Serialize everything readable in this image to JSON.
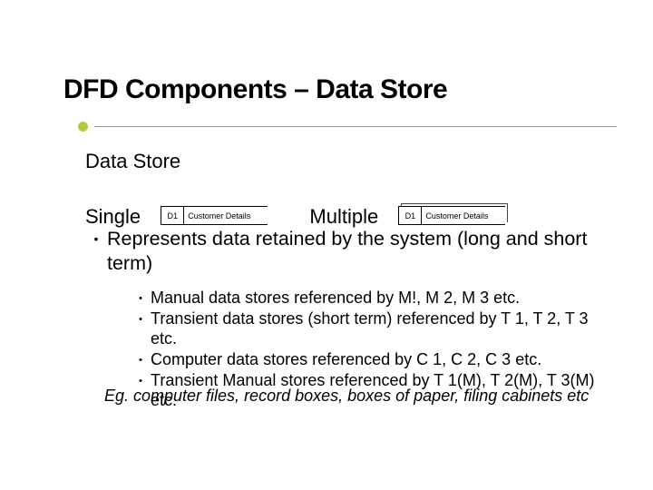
{
  "title": "DFD Components – Data Store",
  "subheading": "Data Store",
  "types": {
    "single": {
      "label": "Single",
      "box_id": "D1",
      "box_label": "Customer Details"
    },
    "multiple": {
      "label": "Multiple",
      "box_id": "D1",
      "box_label": "Customer Details"
    }
  },
  "main_bullet": "Represents data retained by the system (long and short term)",
  "sub_bullets": [
    "Manual data stores referenced by M!, M 2, M 3 etc.",
    "Transient data stores (short term) referenced by T 1, T 2, T 3 etc.",
    "Computer data stores referenced by C 1, C 2, C 3 etc.",
    "Transient Manual stores referenced by T 1(M), T 2(M), T 3(M) etc."
  ],
  "example": "Eg. computer files, record boxes, boxes of paper, filing cabinets etc"
}
